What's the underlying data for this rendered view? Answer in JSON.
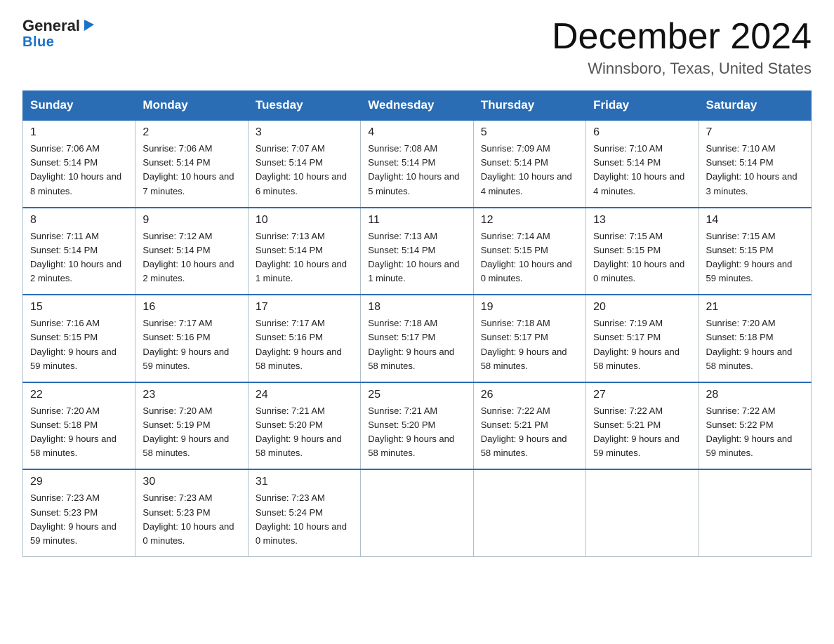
{
  "logo": {
    "general": "General",
    "blue": "Blue",
    "triangle": "▶"
  },
  "header": {
    "title": "December 2024",
    "subtitle": "Winnsboro, Texas, United States"
  },
  "days_of_week": [
    "Sunday",
    "Monday",
    "Tuesday",
    "Wednesday",
    "Thursday",
    "Friday",
    "Saturday"
  ],
  "weeks": [
    [
      {
        "day": "1",
        "sunrise": "7:06 AM",
        "sunset": "5:14 PM",
        "daylight": "10 hours and 8 minutes."
      },
      {
        "day": "2",
        "sunrise": "7:06 AM",
        "sunset": "5:14 PM",
        "daylight": "10 hours and 7 minutes."
      },
      {
        "day": "3",
        "sunrise": "7:07 AM",
        "sunset": "5:14 PM",
        "daylight": "10 hours and 6 minutes."
      },
      {
        "day": "4",
        "sunrise": "7:08 AM",
        "sunset": "5:14 PM",
        "daylight": "10 hours and 5 minutes."
      },
      {
        "day": "5",
        "sunrise": "7:09 AM",
        "sunset": "5:14 PM",
        "daylight": "10 hours and 4 minutes."
      },
      {
        "day": "6",
        "sunrise": "7:10 AM",
        "sunset": "5:14 PM",
        "daylight": "10 hours and 4 minutes."
      },
      {
        "day": "7",
        "sunrise": "7:10 AM",
        "sunset": "5:14 PM",
        "daylight": "10 hours and 3 minutes."
      }
    ],
    [
      {
        "day": "8",
        "sunrise": "7:11 AM",
        "sunset": "5:14 PM",
        "daylight": "10 hours and 2 minutes."
      },
      {
        "day": "9",
        "sunrise": "7:12 AM",
        "sunset": "5:14 PM",
        "daylight": "10 hours and 2 minutes."
      },
      {
        "day": "10",
        "sunrise": "7:13 AM",
        "sunset": "5:14 PM",
        "daylight": "10 hours and 1 minute."
      },
      {
        "day": "11",
        "sunrise": "7:13 AM",
        "sunset": "5:14 PM",
        "daylight": "10 hours and 1 minute."
      },
      {
        "day": "12",
        "sunrise": "7:14 AM",
        "sunset": "5:15 PM",
        "daylight": "10 hours and 0 minutes."
      },
      {
        "day": "13",
        "sunrise": "7:15 AM",
        "sunset": "5:15 PM",
        "daylight": "10 hours and 0 minutes."
      },
      {
        "day": "14",
        "sunrise": "7:15 AM",
        "sunset": "5:15 PM",
        "daylight": "9 hours and 59 minutes."
      }
    ],
    [
      {
        "day": "15",
        "sunrise": "7:16 AM",
        "sunset": "5:15 PM",
        "daylight": "9 hours and 59 minutes."
      },
      {
        "day": "16",
        "sunrise": "7:17 AM",
        "sunset": "5:16 PM",
        "daylight": "9 hours and 59 minutes."
      },
      {
        "day": "17",
        "sunrise": "7:17 AM",
        "sunset": "5:16 PM",
        "daylight": "9 hours and 58 minutes."
      },
      {
        "day": "18",
        "sunrise": "7:18 AM",
        "sunset": "5:17 PM",
        "daylight": "9 hours and 58 minutes."
      },
      {
        "day": "19",
        "sunrise": "7:18 AM",
        "sunset": "5:17 PM",
        "daylight": "9 hours and 58 minutes."
      },
      {
        "day": "20",
        "sunrise": "7:19 AM",
        "sunset": "5:17 PM",
        "daylight": "9 hours and 58 minutes."
      },
      {
        "day": "21",
        "sunrise": "7:20 AM",
        "sunset": "5:18 PM",
        "daylight": "9 hours and 58 minutes."
      }
    ],
    [
      {
        "day": "22",
        "sunrise": "7:20 AM",
        "sunset": "5:18 PM",
        "daylight": "9 hours and 58 minutes."
      },
      {
        "day": "23",
        "sunrise": "7:20 AM",
        "sunset": "5:19 PM",
        "daylight": "9 hours and 58 minutes."
      },
      {
        "day": "24",
        "sunrise": "7:21 AM",
        "sunset": "5:20 PM",
        "daylight": "9 hours and 58 minutes."
      },
      {
        "day": "25",
        "sunrise": "7:21 AM",
        "sunset": "5:20 PM",
        "daylight": "9 hours and 58 minutes."
      },
      {
        "day": "26",
        "sunrise": "7:22 AM",
        "sunset": "5:21 PM",
        "daylight": "9 hours and 58 minutes."
      },
      {
        "day": "27",
        "sunrise": "7:22 AM",
        "sunset": "5:21 PM",
        "daylight": "9 hours and 59 minutes."
      },
      {
        "day": "28",
        "sunrise": "7:22 AM",
        "sunset": "5:22 PM",
        "daylight": "9 hours and 59 minutes."
      }
    ],
    [
      {
        "day": "29",
        "sunrise": "7:23 AM",
        "sunset": "5:23 PM",
        "daylight": "9 hours and 59 minutes."
      },
      {
        "day": "30",
        "sunrise": "7:23 AM",
        "sunset": "5:23 PM",
        "daylight": "10 hours and 0 minutes."
      },
      {
        "day": "31",
        "sunrise": "7:23 AM",
        "sunset": "5:24 PM",
        "daylight": "10 hours and 0 minutes."
      },
      null,
      null,
      null,
      null
    ]
  ],
  "labels": {
    "sunrise": "Sunrise:",
    "sunset": "Sunset:",
    "daylight": "Daylight:"
  }
}
